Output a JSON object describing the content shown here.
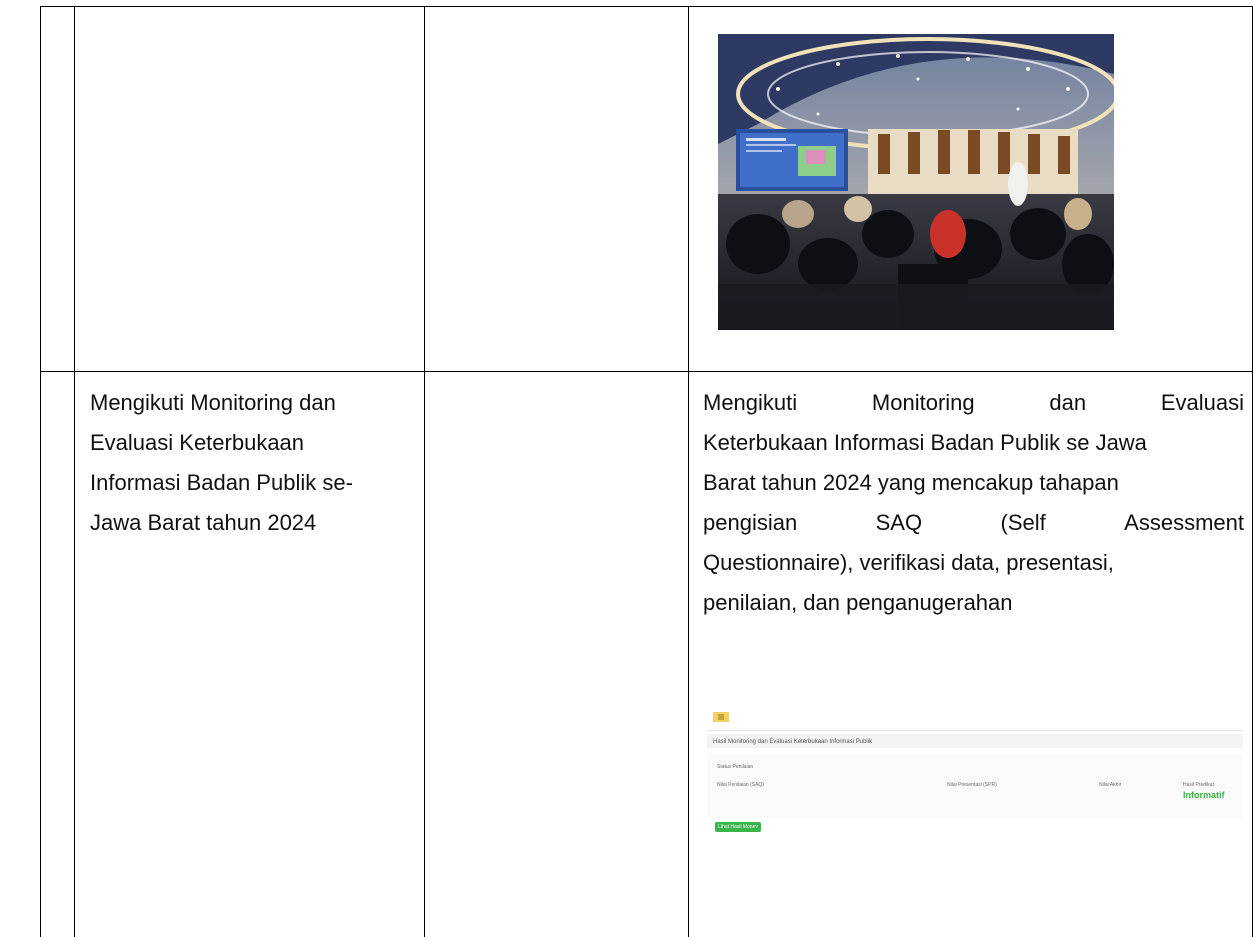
{
  "row2": {
    "activity_lines": [
      "Mengikuti Monitoring dan",
      "Evaluasi Keterbukaan",
      "Informasi Badan Publik se-",
      "Jawa Barat tahun 2024"
    ],
    "description_lines": [
      [
        "Mengikuti",
        "Monitoring",
        "dan",
        "Evaluasi"
      ],
      [
        "Keterbukaan Informasi Badan Publik se Jawa"
      ],
      [
        "Barat tahun 2024 yang mencakup tahapan"
      ],
      [
        "pengisian",
        "SAQ",
        "(Self",
        "Assessment"
      ],
      [
        "Questionnaire), verifikasi data, presentasi,"
      ],
      [
        "penilaian, dan penganugerahan"
      ]
    ]
  },
  "screenshot": {
    "heading": "Hasil Monitoring dan Evaluasi Keterbukaan Informasi Publik",
    "status_label": "Status Penilaian",
    "result_label": "Hasil Predikat",
    "result_value": "Informatif",
    "button_label": "Lihat Hasil Monev",
    "col_nilai_saq": "Nilai Penilaian (SAQ)",
    "col_nilai_presentasi": "Nilai Presentasi (SPR)",
    "col_nilai_akhir": "Nilai Akhir"
  }
}
